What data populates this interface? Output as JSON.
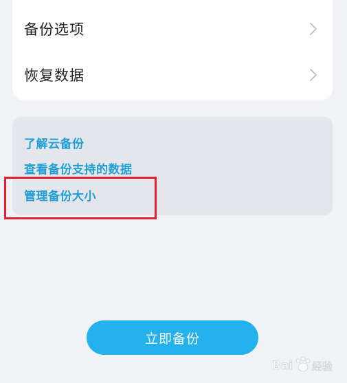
{
  "settings": {
    "items": [
      {
        "label": "备份选项",
        "icon": "chevron-right-icon"
      },
      {
        "label": "恢复数据",
        "icon": "chevron-right-icon"
      }
    ]
  },
  "info": {
    "links": [
      {
        "label": "了解云备份"
      },
      {
        "label": "查看备份支持的数据"
      },
      {
        "label": "管理备份大小"
      }
    ]
  },
  "actions": {
    "backup_now_label": "立即备份"
  },
  "colors": {
    "accent": "#23b2ee",
    "link": "#1f9fd7",
    "highlight": "#e0232b",
    "background": "#f1f2f6"
  },
  "watermark": {
    "text": "Bai经验"
  }
}
